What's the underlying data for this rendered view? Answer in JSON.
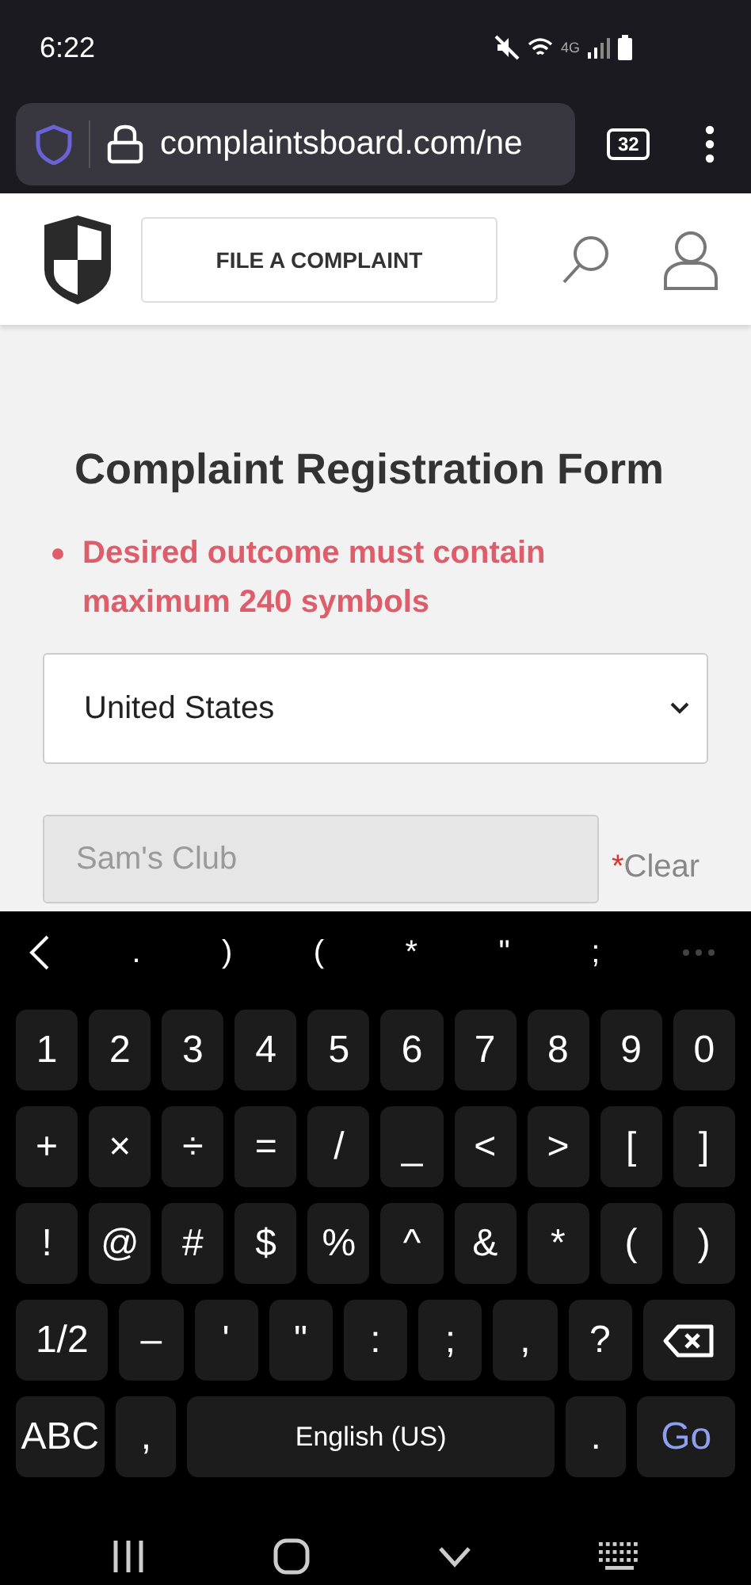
{
  "status_bar": {
    "time": "6:22",
    "network": "4G"
  },
  "browser": {
    "url": "complaintsboard.com/ne",
    "tab_count": "32"
  },
  "header": {
    "file_button": "FILE A COMPLAINT"
  },
  "form": {
    "title": "Complaint Registration Form",
    "errors": [
      "Desired outcome must contain maximum 240 symbols"
    ],
    "country": {
      "value": "United States"
    },
    "company": {
      "value": "Sam's Club",
      "disabled": true,
      "required_mark": "*",
      "clear": "Clear"
    }
  },
  "keyboard": {
    "suggestions": [
      ".",
      ")",
      "(",
      "*",
      "\"",
      ";"
    ],
    "key_lines": [
      [
        {
          "kind": "key",
          "label": "1"
        },
        {
          "kind": "key",
          "label": "2"
        },
        {
          "kind": "key",
          "label": "3"
        },
        {
          "kind": "key",
          "label": "4"
        },
        {
          "kind": "key",
          "label": "5"
        },
        {
          "kind": "key",
          "label": "6"
        },
        {
          "kind": "key",
          "label": "7"
        },
        {
          "kind": "key",
          "label": "8"
        },
        {
          "kind": "key",
          "label": "9"
        },
        {
          "kind": "key",
          "label": "0"
        }
      ],
      [
        {
          "kind": "key",
          "label": "+"
        },
        {
          "kind": "key",
          "label": "×"
        },
        {
          "kind": "key",
          "label": "÷"
        },
        {
          "kind": "key",
          "label": "="
        },
        {
          "kind": "key",
          "label": "/"
        },
        {
          "kind": "key",
          "label": "_"
        },
        {
          "kind": "key",
          "label": "<"
        },
        {
          "kind": "key",
          "label": ">"
        },
        {
          "kind": "key",
          "label": "["
        },
        {
          "kind": "key",
          "label": "]"
        }
      ],
      [
        {
          "kind": "key",
          "label": "!"
        },
        {
          "kind": "key",
          "label": "@"
        },
        {
          "kind": "key",
          "label": "#"
        },
        {
          "kind": "key",
          "label": "$"
        },
        {
          "kind": "key",
          "label": "%"
        },
        {
          "kind": "key",
          "label": "^"
        },
        {
          "kind": "key",
          "label": "&"
        },
        {
          "kind": "key",
          "label": "*"
        },
        {
          "kind": "key",
          "label": "("
        },
        {
          "kind": "key",
          "label": ")"
        }
      ],
      [
        {
          "kind": "wide",
          "label": "1/2"
        },
        {
          "kind": "key",
          "label": "–"
        },
        {
          "kind": "key",
          "label": "'"
        },
        {
          "kind": "key",
          "label": "\""
        },
        {
          "kind": "key",
          "label": ":"
        },
        {
          "kind": "key",
          "label": ";"
        },
        {
          "kind": "key",
          "label": ","
        },
        {
          "kind": "key",
          "label": "?"
        },
        {
          "kind": "backspace"
        }
      ],
      [
        {
          "kind": "wide",
          "label": "ABC"
        },
        {
          "kind": "key",
          "label": ","
        },
        {
          "kind": "space",
          "label": "English (US)"
        },
        {
          "kind": "key",
          "label": "."
        },
        {
          "kind": "action",
          "label": "Go"
        }
      ]
    ]
  }
}
